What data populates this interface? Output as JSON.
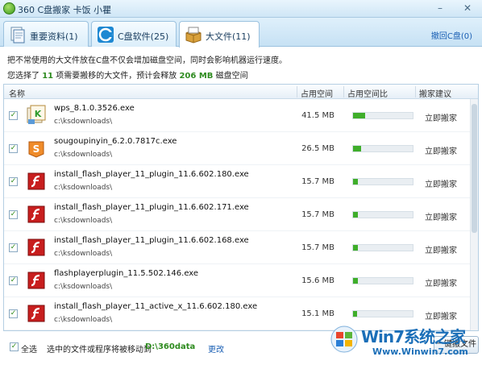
{
  "window": {
    "title": "360 C盘搬家  卡饭 小瞿"
  },
  "tabs": [
    {
      "label": "重要资料(1)",
      "icon": "documents-icon",
      "active": false
    },
    {
      "label": "C盘软件(25)",
      "icon": "disk-c-icon",
      "active": false
    },
    {
      "label": "大文件(11)",
      "icon": "box-icon",
      "active": true
    }
  ],
  "restore_link": "撤回C盘(0)",
  "description": {
    "line1": "把不常使用的大文件放在C盘不仅会增加磁盘空间，同时会影响机器运行速度。",
    "line2_prefix": "您选择了 ",
    "selected_count": "11",
    "line2_mid": " 项需要搬移的大文件，预计会释放 ",
    "release_size": "206 MB",
    "line2_suffix": " 磁盘空间"
  },
  "columns": {
    "name": "名称",
    "size": "占用空间",
    "ratio": "占用空间比",
    "suggest": "搬家建议"
  },
  "rows": [
    {
      "name": "wps_8.1.0.3526.exe",
      "path": "c:\\ksdownloads\\",
      "size": "41.5 MB",
      "ratio": 0.2,
      "action": "立即搬家",
      "icon": "wps-installer-icon",
      "checked": true
    },
    {
      "name": "sougoupinyin_6.2.0.7817c.exe",
      "path": "c:\\ksdownloads\\",
      "size": "26.5 MB",
      "ratio": 0.13,
      "action": "立即搬家",
      "icon": "sogou-pinyin-icon",
      "checked": true
    },
    {
      "name": "install_flash_player_11_plugin_11.6.602.180.exe",
      "path": "c:\\ksdownloads\\",
      "size": "15.7 MB",
      "ratio": 0.08,
      "action": "立即搬家",
      "icon": "flash-icon",
      "checked": true
    },
    {
      "name": "install_flash_player_11_plugin_11.6.602.171.exe",
      "path": "c:\\ksdownloads\\",
      "size": "15.7 MB",
      "ratio": 0.08,
      "action": "立即搬家",
      "icon": "flash-icon",
      "checked": true
    },
    {
      "name": "install_flash_player_11_plugin_11.6.602.168.exe",
      "path": "c:\\ksdownloads\\",
      "size": "15.7 MB",
      "ratio": 0.08,
      "action": "立即搬家",
      "icon": "flash-icon",
      "checked": true
    },
    {
      "name": "flashplayerplugin_11.5.502.146.exe",
      "path": "c:\\ksdownloads\\",
      "size": "15.6 MB",
      "ratio": 0.08,
      "action": "立即搬家",
      "icon": "flash-icon",
      "checked": true
    },
    {
      "name": "install_flash_player_11_active_x_11.6.602.180.exe",
      "path": "c:\\ksdownloads\\",
      "size": "15.1 MB",
      "ratio": 0.07,
      "action": "立即搬家",
      "icon": "flash-icon",
      "checked": true
    }
  ],
  "footer": {
    "select_all": "全选",
    "move_text": "选中的文件或程序将被移动到",
    "target_path": "D:\\360data",
    "change_link": "更改",
    "move_button": "一键搬文件"
  },
  "watermark": {
    "title": "Win7系统之家",
    "url": "Www.Winwin7.com"
  },
  "colors": {
    "accent_green": "#3fae2a",
    "link_blue": "#1a5fb4",
    "flash_red": "#c81e1e"
  }
}
